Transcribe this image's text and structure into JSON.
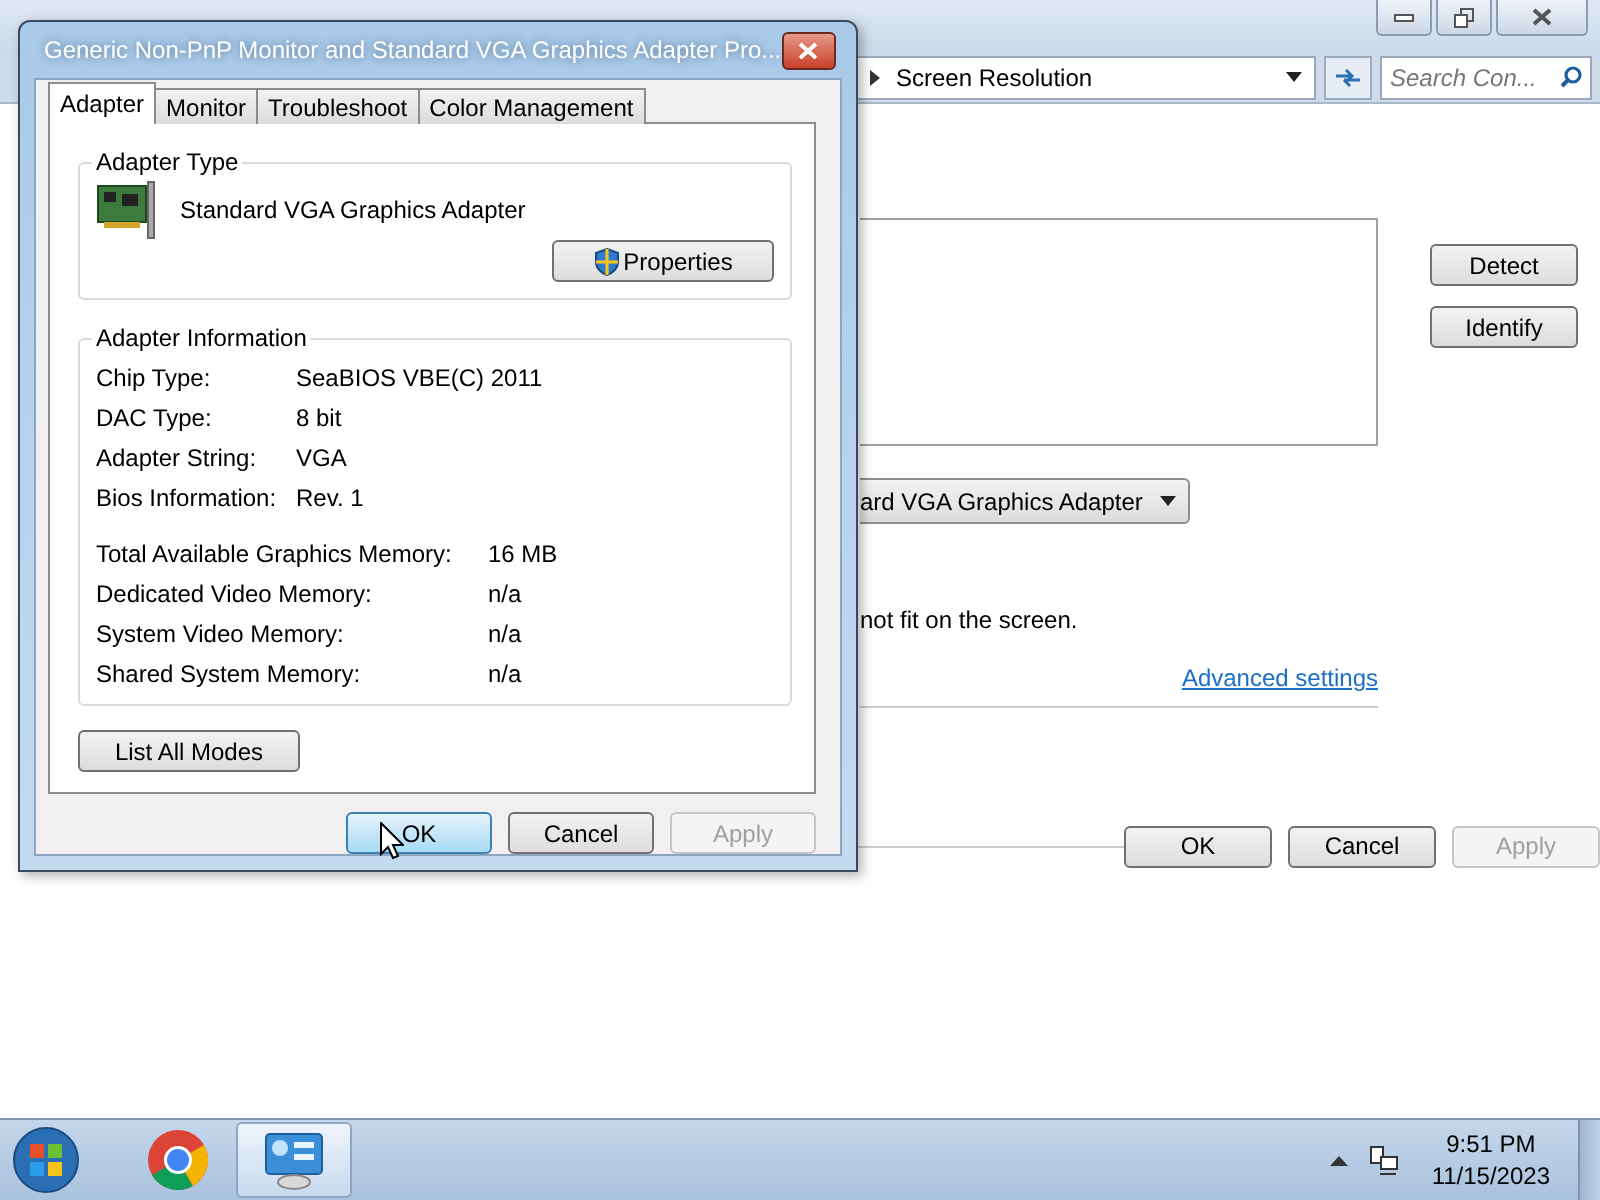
{
  "window": {
    "breadcrumb": "Screen Resolution",
    "search": {
      "placeholder": "Search Con..."
    },
    "side_buttons": [
      "Detect",
      "Identify"
    ],
    "display_select": "ard VGA Graphics Adapter",
    "note": "not fit on the screen.",
    "link": "Advanced settings",
    "buttons": [
      {
        "label": "OK",
        "disabled": false
      },
      {
        "label": "Cancel",
        "disabled": false
      },
      {
        "label": "Apply",
        "disabled": true
      }
    ]
  },
  "dialog": {
    "title": "Generic Non-PnP Monitor and Standard VGA Graphics Adapter Pro...",
    "tabs": [
      {
        "label": "Adapter",
        "selected": true
      },
      {
        "label": "Monitor",
        "selected": false
      },
      {
        "label": "Troubleshoot",
        "selected": false
      },
      {
        "label": "Color Management",
        "selected": false
      }
    ],
    "adapter_type": {
      "heading": "Adapter Type",
      "name": "Standard VGA Graphics Adapter",
      "button": "Properties"
    },
    "adapter_info": {
      "heading": "Adapter Information",
      "rows": [
        {
          "label": "Chip Type:",
          "value": "SeaBIOS VBE(C) 2011"
        },
        {
          "label": "DAC Type:",
          "value": "8 bit"
        },
        {
          "label": "Adapter String:",
          "value": "VGA"
        },
        {
          "label": "Bios Information:",
          "value": "Rev. 1"
        }
      ],
      "memory_rows": [
        {
          "label": "Total Available Graphics Memory:",
          "value": "16 MB"
        },
        {
          "label": "Dedicated Video Memory:",
          "value": "n/a"
        },
        {
          "label": "System Video Memory:",
          "value": "n/a"
        },
        {
          "label": "Shared System Memory:",
          "value": "n/a"
        }
      ]
    },
    "list_button": "List All Modes",
    "buttons": [
      {
        "label": "OK",
        "disabled": false,
        "default": true
      },
      {
        "label": "Cancel",
        "disabled": false,
        "default": false
      },
      {
        "label": "Apply",
        "disabled": true,
        "default": false
      }
    ]
  },
  "taskbar": {
    "apps": [
      {
        "kind": "chrome",
        "selected": false
      },
      {
        "kind": "control-panel",
        "selected": true
      }
    ],
    "time": "9:51 PM",
    "date": "11/15/2023"
  }
}
